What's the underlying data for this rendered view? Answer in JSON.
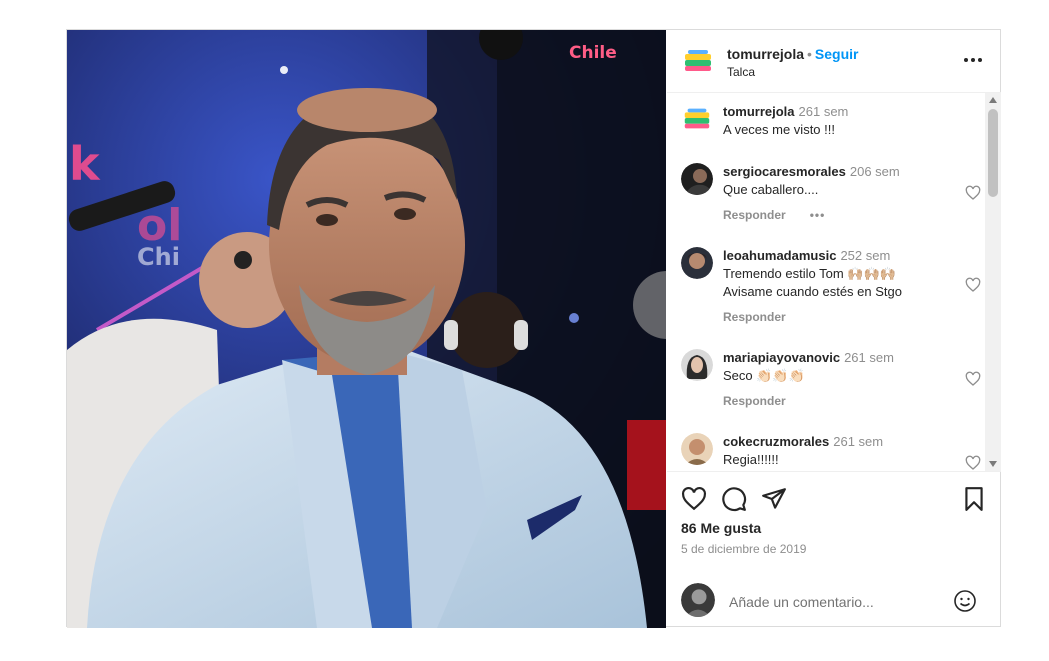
{
  "post": {
    "author": "tomurrejola",
    "separator": "•",
    "follow_label": "Seguir",
    "location": "Talca",
    "likes": "86 Me gusta",
    "date": "5 de diciembre de 2019",
    "comment_placeholder": "Añade un comentario...",
    "media_caption_fragment": "Chile"
  },
  "comments": [
    {
      "user": "tomurrejola",
      "time": "261 sem",
      "lines": [
        "A veces me visto !!!"
      ],
      "reply": "",
      "more": "",
      "avatar": "logo"
    },
    {
      "user": "sergiocaresmorales",
      "time": "206 sem",
      "lines": [
        "Que caballero...."
      ],
      "reply": "Responder",
      "more": "•••",
      "avatar": "photo"
    },
    {
      "user": "leoahumadamusic",
      "time": "252 sem",
      "lines": [
        "Tremendo estilo Tom 🙌🏼🙌🏼🙌🏼",
        "Avisame cuando estés en Stgo"
      ],
      "reply": "Responder",
      "more": "",
      "avatar": "photo"
    },
    {
      "user": "mariapiayovanovic",
      "time": "261 sem",
      "lines": [
        "Seco 👏🏻👏🏻👏🏻"
      ],
      "reply": "Responder",
      "more": "",
      "avatar": "photo"
    },
    {
      "user": "cokecruzmorales",
      "time": "261 sem",
      "lines": [
        "Regia!!!!!!"
      ],
      "reply": "",
      "more": "",
      "avatar": "photo"
    }
  ],
  "icons": [
    "heart-icon",
    "comment-icon",
    "share-icon",
    "bookmark-icon",
    "more-icon",
    "emoji-icon"
  ],
  "colors": {
    "accent": "#0095f6",
    "muted": "#8e8e8e",
    "text": "#262626"
  }
}
